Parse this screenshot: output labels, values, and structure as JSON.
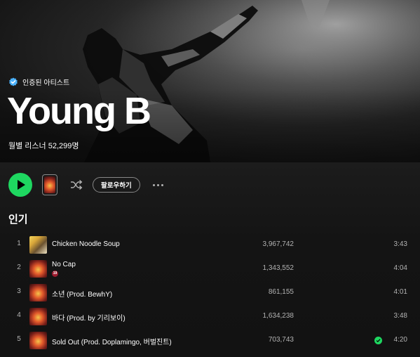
{
  "hero": {
    "verified_label": "인증된 아티스트",
    "artist_name": "Young B",
    "monthly_listeners": "월별 리스너 52,299명"
  },
  "actions": {
    "follow_label": "팔로우하기"
  },
  "popular": {
    "title": "인기",
    "tracks": [
      {
        "num": "1",
        "title": "Chicken Noodle Soup",
        "plays": "3,967,742",
        "duration": "3:43",
        "explicit": false,
        "saved": false
      },
      {
        "num": "2",
        "title": "No Cap",
        "plays": "1,343,552",
        "duration": "4:04",
        "explicit": true,
        "explicit_label": "19",
        "saved": false
      },
      {
        "num": "3",
        "title": "소년 (Prod. BewhY)",
        "plays": "861,155",
        "duration": "4:01",
        "explicit": false,
        "saved": false
      },
      {
        "num": "4",
        "title": "바다 (Prod. by 기리보이)",
        "plays": "1,634,238",
        "duration": "3:48",
        "explicit": false,
        "saved": false
      },
      {
        "num": "5",
        "title": "Sold Out (Prod. Doplamingo, 버벌진트)",
        "plays": "703,743",
        "duration": "4:20",
        "explicit": false,
        "saved": true
      }
    ]
  },
  "colors": {
    "accent": "#1ed760",
    "verified": "#4cb3ff",
    "background": "#121212",
    "subtext": "#b3b3b3"
  }
}
